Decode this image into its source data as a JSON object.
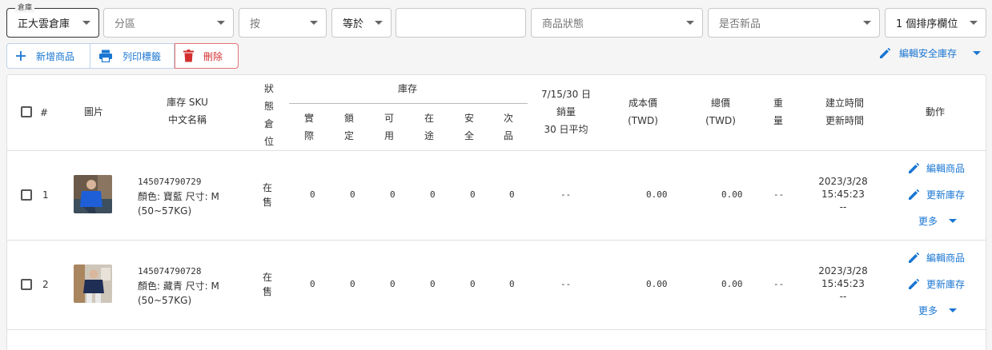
{
  "filters": {
    "warehouse": {
      "legend": "倉庫",
      "value": "正大雲倉庫"
    },
    "zone": {
      "placeholder": "分區"
    },
    "by": {
      "placeholder": "按"
    },
    "operator": {
      "value": "等於"
    },
    "value_input": {
      "placeholder": ""
    },
    "product_status": {
      "placeholder": "商品狀態"
    },
    "is_new": {
      "placeholder": "是否新品"
    },
    "sort": {
      "value": "1 個排序欄位"
    }
  },
  "actions": {
    "add_label": "新增商品",
    "print_label": "列印標籤",
    "delete_label": "刪除",
    "edit_safety_label": "編輯安全庫存"
  },
  "table": {
    "headers": {
      "index": "#",
      "image": "圖片",
      "sku_line1": "庫存 SKU",
      "sku_line2": "中文名稱",
      "status": [
        "狀",
        "態",
        "倉",
        "位"
      ],
      "stock_group": "庫存",
      "stock_cols": [
        [
          "實",
          "際"
        ],
        [
          "鎖",
          "定"
        ],
        [
          "可",
          "用"
        ],
        [
          "在",
          "途"
        ],
        [
          "安",
          "全"
        ],
        [
          "次",
          "品"
        ]
      ],
      "sales_line1": "7/15/30 日",
      "sales_line2": "銷量",
      "sales_line3": "30 日平均",
      "cost_line1": "成本價",
      "cost_line2": "(TWD)",
      "total_line1": "總價",
      "total_line2": "(TWD)",
      "weight": [
        "重",
        "量"
      ],
      "time_line1": "建立時間",
      "time_line2": "更新時間",
      "action": "動作"
    },
    "rows": [
      {
        "index": "1",
        "image_icon": "product-photo-blue-shirt",
        "sku": "145074790729",
        "attr_line1": "顏色: 寶藍 尺寸: M",
        "attr_line2": "(50~57KG)",
        "status": [
          "在",
          "售"
        ],
        "stock": [
          "0",
          "0",
          "0",
          "0",
          "0",
          "0"
        ],
        "sales": "--",
        "cost": "0.00",
        "total": "0.00",
        "weight": "--",
        "created": "2023/3/28",
        "time": "15:45:23",
        "updated": "--",
        "edit_product": "編輯商品",
        "update_stock": "更新庫存",
        "more": "更多"
      },
      {
        "index": "2",
        "image_icon": "product-photo-navy-shirt",
        "sku": "145074790728",
        "attr_line1": "顏色: 藏青 尺寸: M",
        "attr_line2": "(50~57KG)",
        "status": [
          "在",
          "售"
        ],
        "stock": [
          "0",
          "0",
          "0",
          "0",
          "0",
          "0"
        ],
        "sales": "--",
        "cost": "0.00",
        "total": "0.00",
        "weight": "--",
        "created": "2023/3/28",
        "time": "15:45:23",
        "updated": "--",
        "edit_product": "編輯商品",
        "update_stock": "更新庫存",
        "more": "更多"
      }
    ]
  },
  "colors": {
    "primary": "#1976d2",
    "danger": "#d32f2f",
    "border": "#e0e0e0"
  }
}
